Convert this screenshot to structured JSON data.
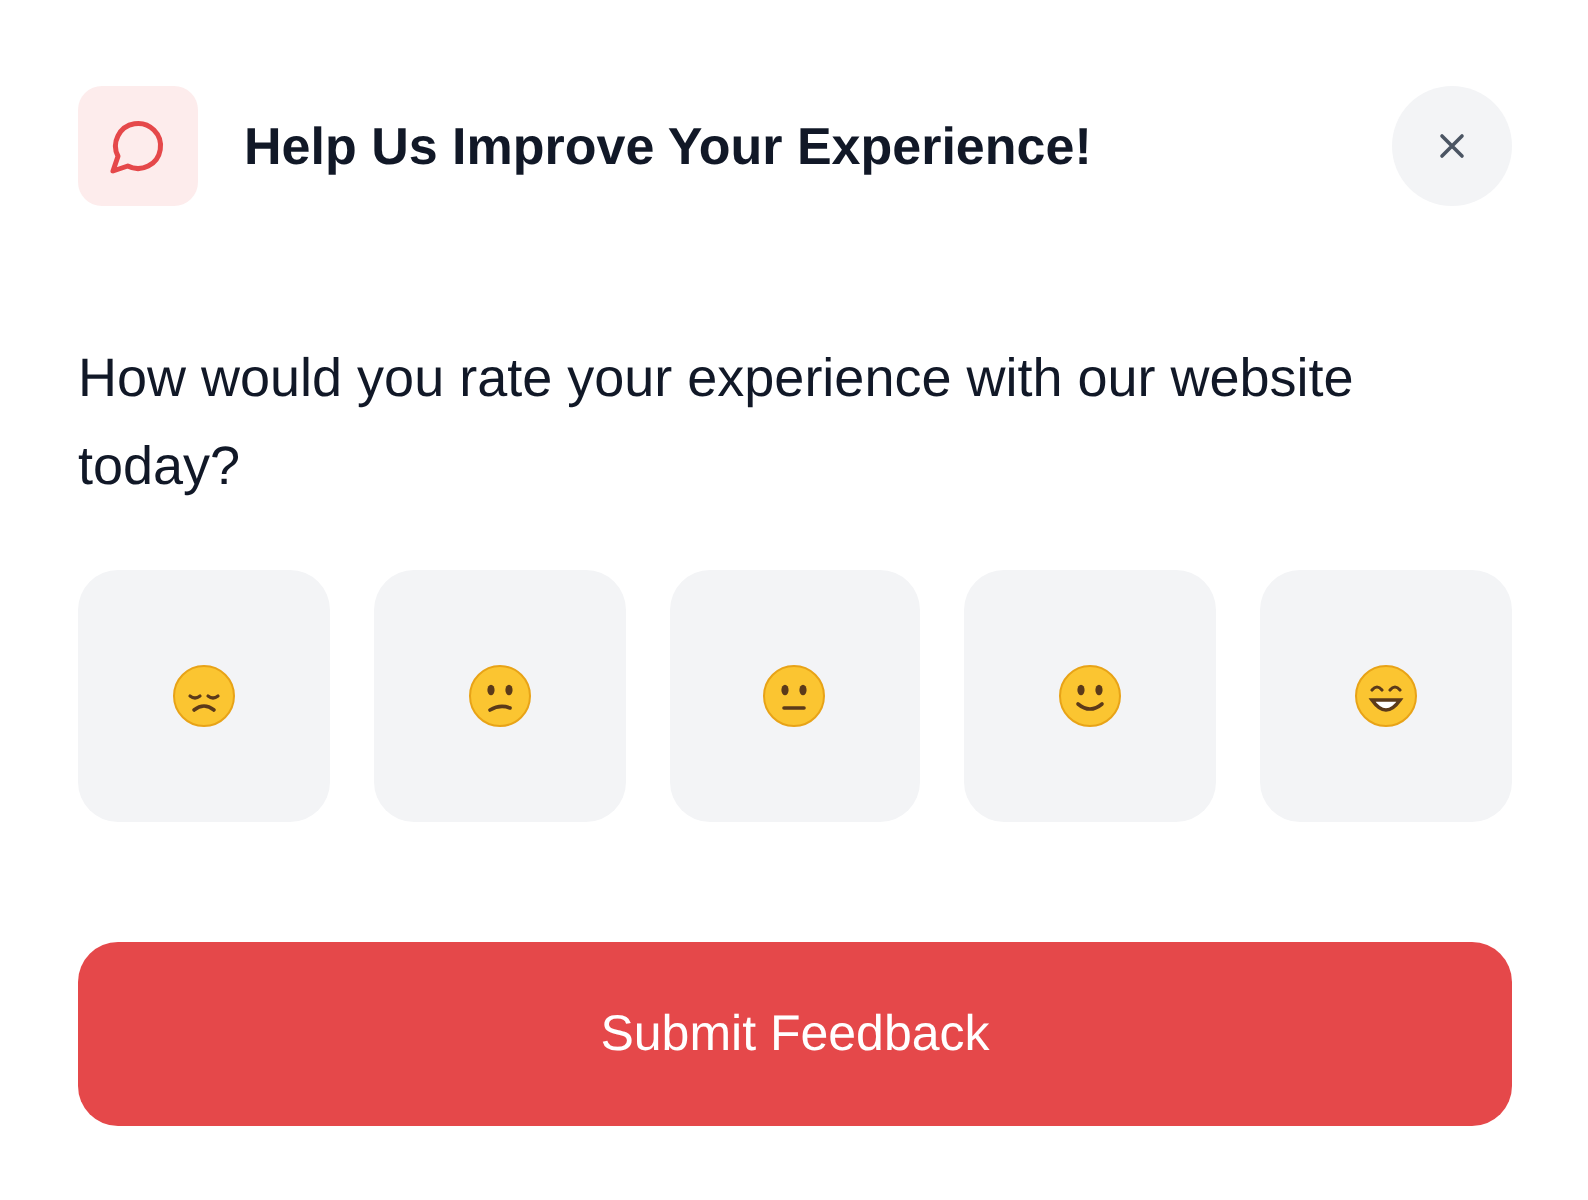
{
  "header": {
    "title": "Help Us Improve Your Experience!"
  },
  "question": "How would you rate your experience with our website today?",
  "ratings": [
    {
      "kind": "disappointed",
      "selected": false
    },
    {
      "kind": "confused",
      "selected": false
    },
    {
      "kind": "neutral",
      "selected": false
    },
    {
      "kind": "smiling",
      "selected": false
    },
    {
      "kind": "grinning",
      "selected": false
    }
  ],
  "submit_button": "Submit Feedback"
}
